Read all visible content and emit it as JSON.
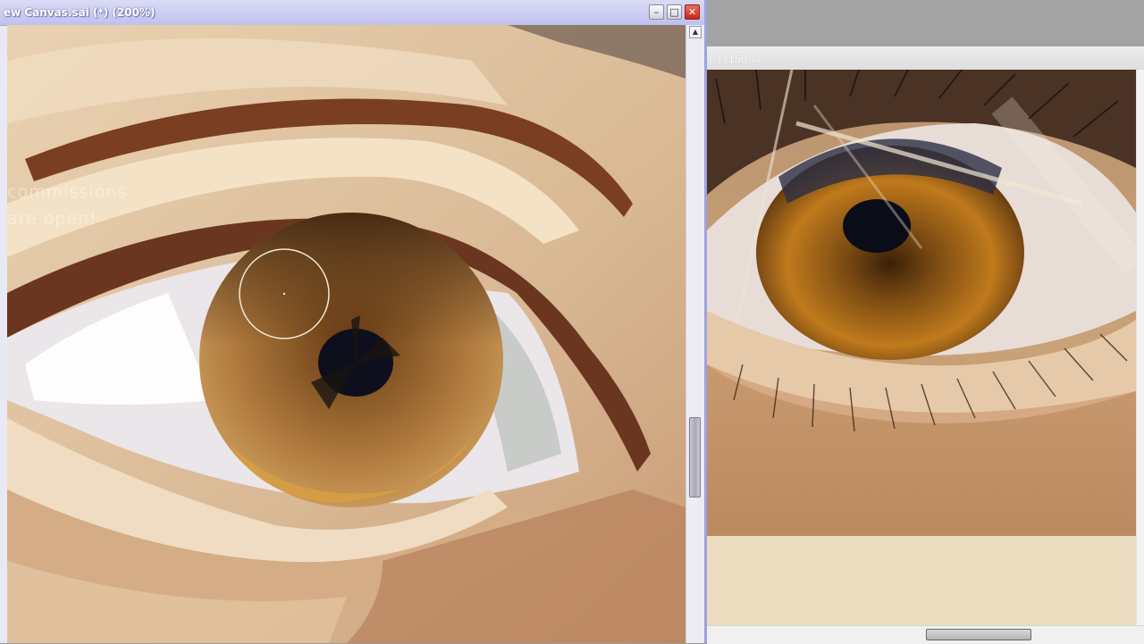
{
  "canvas_window": {
    "title": "ew Canvas.sai (*) (200%)",
    "minimize_label": "–",
    "maximize_label": "□",
    "close_label": "✕",
    "scroll_up_label": "▲",
    "watermark_line1": "commissions",
    "watermark_line2": "are  open!",
    "close_color": "#d9382a"
  },
  "reference_window": {
    "title": "(*) (150%)"
  }
}
